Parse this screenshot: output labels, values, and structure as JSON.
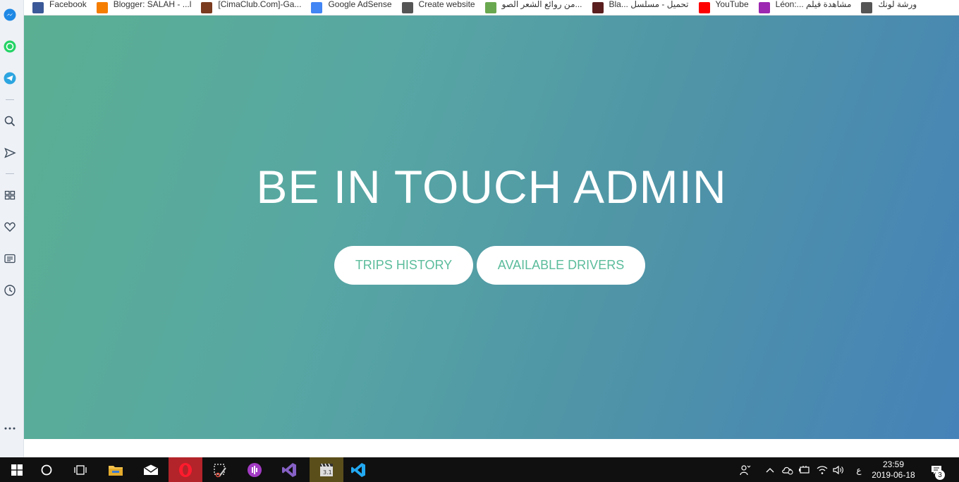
{
  "bookmarks": [
    {
      "label": "Facebook",
      "icon": "facebook-icon",
      "color": "#3b5998"
    },
    {
      "label": "Blogger: SALAH - ...l",
      "icon": "blogger-icon",
      "color": "#f57d00"
    },
    {
      "label": "[CimaClub.Com]-Ga...",
      "icon": "cimaclub-icon",
      "color": "#7a3b1e"
    },
    {
      "label": "Google AdSense",
      "icon": "adsense-icon",
      "color": "#4285f4"
    },
    {
      "label": "Create website",
      "icon": "page-icon",
      "color": "#555555"
    },
    {
      "label": "من روائع الشعر الصو...",
      "icon": "poetry-icon",
      "color": "#6aa84f"
    },
    {
      "label": "Bla... تحميل - مسلسل",
      "icon": "series-icon",
      "color": "#5a1e1e"
    },
    {
      "label": "YouTube",
      "icon": "youtube-icon",
      "color": "#ff0000"
    },
    {
      "label": "Léon:... مشاهدة فيلم",
      "icon": "movie-icon",
      "color": "#9c27b0"
    },
    {
      "label": "ورشة لونك",
      "icon": "page-icon",
      "color": "#555555"
    }
  ],
  "hero": {
    "title": "BE IN TOUCH ADMIN",
    "trips_button": "TRIPS HISTORY",
    "drivers_button": "AVAILABLE DRIVERS"
  },
  "taskbar": {
    "language": "ع",
    "time": "23:59",
    "date": "2019-06-18",
    "notification_count": "3"
  },
  "colors": {
    "accent": "#5bbc9c",
    "gradient_start": "#5aaf92",
    "gradient_end": "#4582b8"
  }
}
